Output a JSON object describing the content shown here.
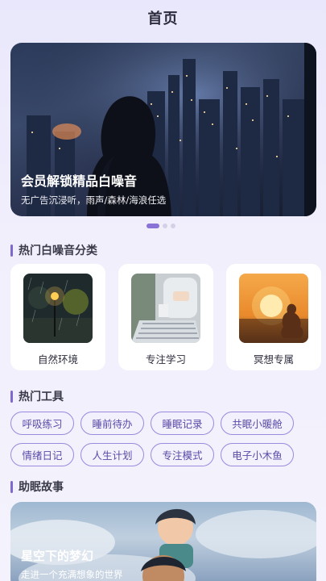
{
  "header": {
    "title": "首页"
  },
  "banner": {
    "title": "会员解锁精品白噪音",
    "subtitle": "无广告沉浸听，雨声/森林/海浪任选",
    "pages": 3,
    "active_page": 1
  },
  "categories": {
    "section_title": "热门白噪音分类",
    "items": [
      {
        "label": "自然环境"
      },
      {
        "label": "专注学习"
      },
      {
        "label": "冥想专属"
      }
    ]
  },
  "tools": {
    "section_title": "热门工具",
    "rows": [
      [
        "呼吸练习",
        "睡前待办",
        "睡眠记录",
        "共眠小暖舱"
      ],
      [
        "情绪日记",
        "人生计划",
        "专注模式",
        "电子小木鱼"
      ]
    ]
  },
  "stories": {
    "section_title": "助眠故事",
    "items": [
      {
        "title": "星空下的梦幻",
        "subtitle": "走进一个充满想象的世界"
      }
    ]
  },
  "colors": {
    "accent": "#7f69cf",
    "chip_border": "#9b8ae0",
    "chip_text": "#5b4aa8"
  }
}
